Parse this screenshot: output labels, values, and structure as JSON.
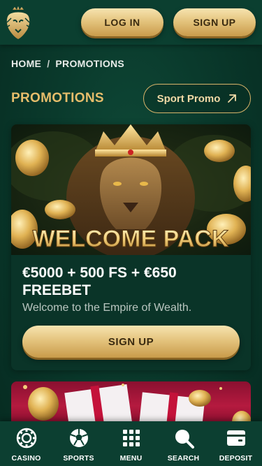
{
  "header": {
    "login_label": "LOG IN",
    "signup_label": "SIGN UP"
  },
  "breadcrumb": {
    "home": "HOME",
    "separator": "/",
    "current": "PROMOTIONS"
  },
  "section": {
    "title": "PROMOTIONS",
    "sport_promo_label": "Sport Promo"
  },
  "promo_card": {
    "banner_text": "WELCOME PACK",
    "title": "€5000 + 500 FS + €650 FREEBET",
    "description": "Welcome to the Empire of Wealth.",
    "button_label": "SIGN UP"
  },
  "bottom_nav": {
    "items": [
      {
        "label": "CASINO",
        "icon": "casino-chip-icon"
      },
      {
        "label": "SPORTS",
        "icon": "soccer-ball-icon"
      },
      {
        "label": "MENU",
        "icon": "grid-menu-icon"
      },
      {
        "label": "SEARCH",
        "icon": "search-icon"
      },
      {
        "label": "DEPOSIT",
        "icon": "wallet-icon"
      }
    ]
  },
  "colors": {
    "accent_gold": "#e6bd6b",
    "background_green": "#0a3a2c",
    "button_gold": "#e4c47e"
  }
}
